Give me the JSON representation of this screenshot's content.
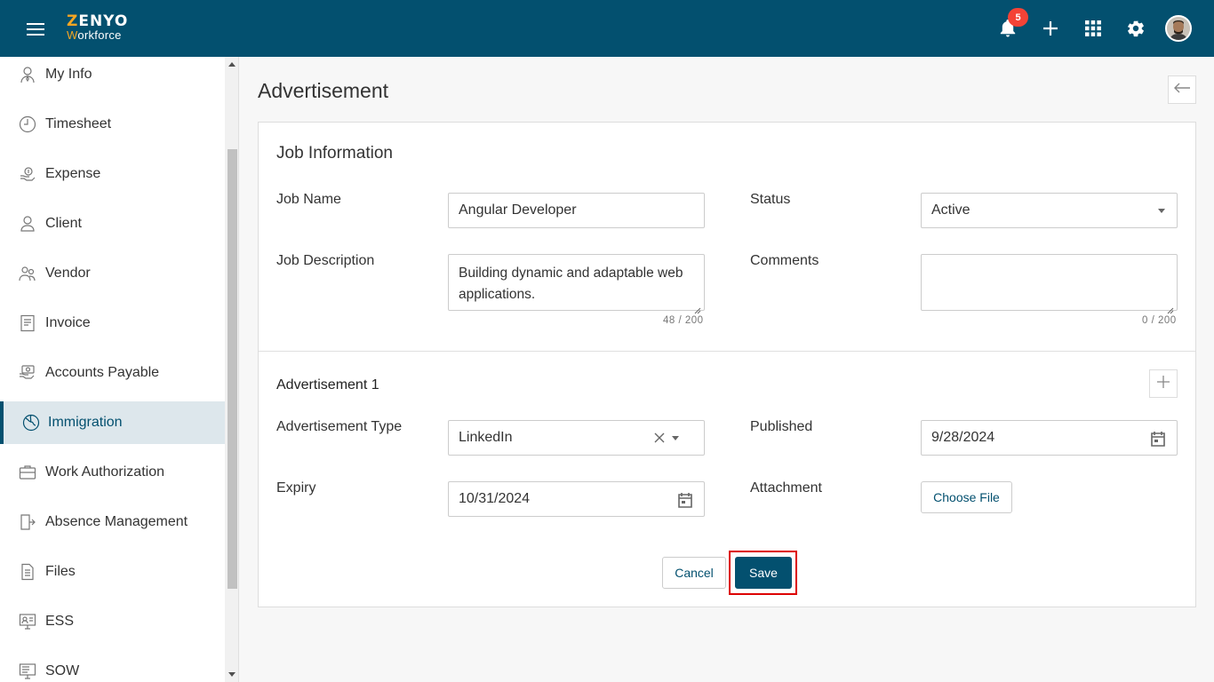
{
  "header": {
    "logo_top": "ZENYO",
    "logo_bottom": "Workforce",
    "notification_count": "5",
    "icons": [
      "menu-icon",
      "bell-icon",
      "plus-icon",
      "apps-grid-icon",
      "gear-icon",
      "avatar"
    ]
  },
  "sidebar": {
    "items": [
      {
        "label": "My Info",
        "icon": "user-tie-icon"
      },
      {
        "label": "Timesheet",
        "icon": "clock-icon"
      },
      {
        "label": "Expense",
        "icon": "money-hand-icon"
      },
      {
        "label": "Client",
        "icon": "person-icon"
      },
      {
        "label": "Vendor",
        "icon": "vendor-icon"
      },
      {
        "label": "Invoice",
        "icon": "invoice-icon"
      },
      {
        "label": "Accounts Payable",
        "icon": "payable-icon"
      },
      {
        "label": "Immigration",
        "icon": "globe-icon"
      },
      {
        "label": "Work Authorization",
        "icon": "briefcase-icon"
      },
      {
        "label": "Absence Management",
        "icon": "exit-door-icon"
      },
      {
        "label": "Files",
        "icon": "file-icon"
      },
      {
        "label": "ESS",
        "icon": "ess-icon"
      },
      {
        "label": "SOW",
        "icon": "sow-icon"
      }
    ],
    "active": "Immigration"
  },
  "main": {
    "title": "Advertisement",
    "job_info": {
      "title": "Job Information",
      "job_name_label": "Job Name",
      "job_name_value": "Angular Developer",
      "status_label": "Status",
      "status_value": "Active",
      "job_desc_label": "Job Description",
      "job_desc_value": "Building dynamic and adaptable web applications.",
      "job_desc_counter": "48 / 200",
      "comments_label": "Comments",
      "comments_value": "",
      "comments_counter": "0 / 200"
    },
    "advertisement": {
      "title": "Advertisement 1",
      "type_label": "Advertisement Type",
      "type_value": "LinkedIn",
      "published_label": "Published",
      "published_value": "9/28/2024",
      "expiry_label": "Expiry",
      "expiry_value": "10/31/2024",
      "attachment_label": "Attachment",
      "choose_file_label": "Choose File"
    },
    "actions": {
      "cancel_label": "Cancel",
      "save_label": "Save"
    }
  },
  "colors": {
    "primary": "#03506f",
    "badge": "#f44336",
    "highlight_outline": "#dd0000",
    "logo_accent": "#f5a623"
  }
}
